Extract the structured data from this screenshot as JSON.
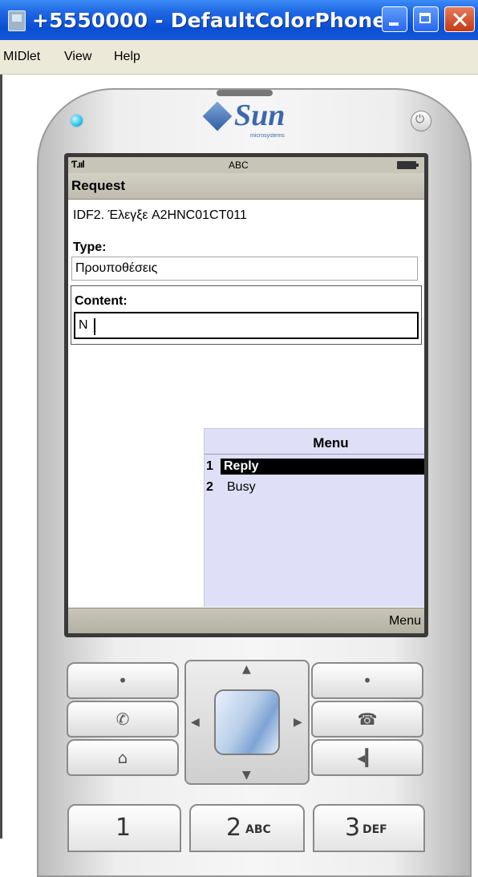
{
  "window": {
    "title": "+5550000 - DefaultColorPhone",
    "menu": [
      "MIDlet",
      "View",
      "Help"
    ]
  },
  "phone": {
    "brand": "Sun",
    "brand_sub": "microsystems",
    "status": {
      "signal": "Ƭ.ııl",
      "input_mode": "ABC"
    },
    "screen_title": "Request",
    "info_text": "IDF2. Έλεγξε A2HNC01CT011",
    "type_label": "Type:",
    "type_value": "Προυποθέσεις",
    "content_label": "Content:",
    "content_value": "N",
    "soft_right": "Menu"
  },
  "popup_menu": {
    "title": "Menu",
    "items": [
      {
        "num": "1",
        "label": "Reply",
        "selected": true
      },
      {
        "num": "2",
        "label": "Busy",
        "selected": false
      }
    ]
  },
  "keypad": {
    "keys": [
      {
        "digit": "1",
        "letters": ""
      },
      {
        "digit": "2",
        "letters": "ABC"
      },
      {
        "digit": "3",
        "letters": "DEF"
      }
    ]
  },
  "colors": {
    "titlebar": "#0a4fd4",
    "menu_bg": "#dfdff7",
    "selection": "#000000",
    "brand": "#3c68ab"
  }
}
